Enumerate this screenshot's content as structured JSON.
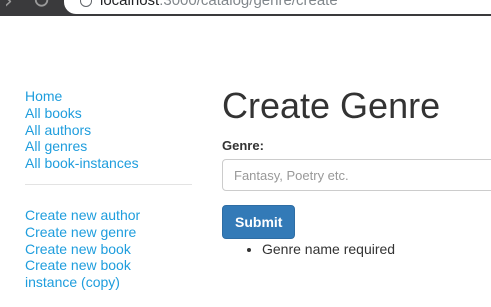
{
  "browser": {
    "forward_glyph": "›",
    "reload_glyph": "↻",
    "url_host": "localhost",
    "url_path": ":3000/catalog/genre/create"
  },
  "sidebar": {
    "primary_links": [
      {
        "label": "Home"
      },
      {
        "label": "All books"
      },
      {
        "label": "All authors"
      },
      {
        "label": "All genres"
      },
      {
        "label": "All book-instances"
      }
    ],
    "create_links": [
      {
        "label": "Create new author"
      },
      {
        "label": "Create new genre"
      },
      {
        "label": "Create new book"
      },
      {
        "label": "Create new book instance (copy)"
      }
    ]
  },
  "main": {
    "title": "Create Genre",
    "genre_label": "Genre:",
    "genre_value": "",
    "genre_placeholder": "Fantasy, Poetry etc.",
    "submit_label": "Submit",
    "errors": [
      "Genre name required"
    ]
  },
  "colors": {
    "link": "#1e9ddd",
    "button_bg": "#337ab7",
    "browser_chrome": "#3a3a3c"
  },
  "icons": [
    "info-icon",
    "forward-icon",
    "reload-icon"
  ]
}
